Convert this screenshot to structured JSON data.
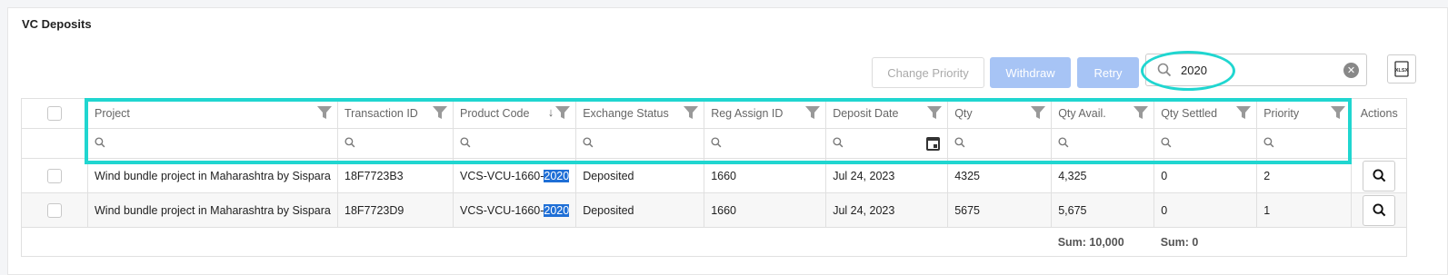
{
  "title": "VC Deposits",
  "toolbar": {
    "change_priority": "Change Priority",
    "withdraw": "Withdraw",
    "retry": "Retry",
    "search_value": "2020",
    "export_label": "XLSX"
  },
  "columns": [
    "Project",
    "Transaction ID",
    "Product Code",
    "Exchange Status",
    "Reg Assign ID",
    "Deposit Date",
    "Qty",
    "Qty Avail.",
    "Qty Settled",
    "Priority",
    "Actions"
  ],
  "rows": [
    {
      "project": "Wind bundle project in Maharashtra by Sispara",
      "transaction_id": "18F7723B3",
      "product_code_prefix": "VCS-VCU-1660-",
      "product_code_match": "2020",
      "exchange_status": "Deposited",
      "reg_assign_id": "1660",
      "deposit_date": "Jul 24, 2023",
      "qty": "4325",
      "qty_avail": "4,325",
      "qty_settled": "0",
      "priority": "2"
    },
    {
      "project": "Wind bundle project in Maharashtra by Sispara",
      "transaction_id": "18F7723D9",
      "product_code_prefix": "VCS-VCU-1660-",
      "product_code_match": "2020",
      "exchange_status": "Deposited",
      "reg_assign_id": "1660",
      "deposit_date": "Jul 24, 2023",
      "qty": "5675",
      "qty_avail": "5,675",
      "qty_settled": "0",
      "priority": "1"
    }
  ],
  "summary": {
    "qty_avail_sum": "Sum: 10,000",
    "qty_settled_sum": "Sum: 0"
  },
  "colors": {
    "highlight": "#20d6d0",
    "primary_disabled": "#a7c4f5",
    "text_selection": "#1f6fd6"
  }
}
